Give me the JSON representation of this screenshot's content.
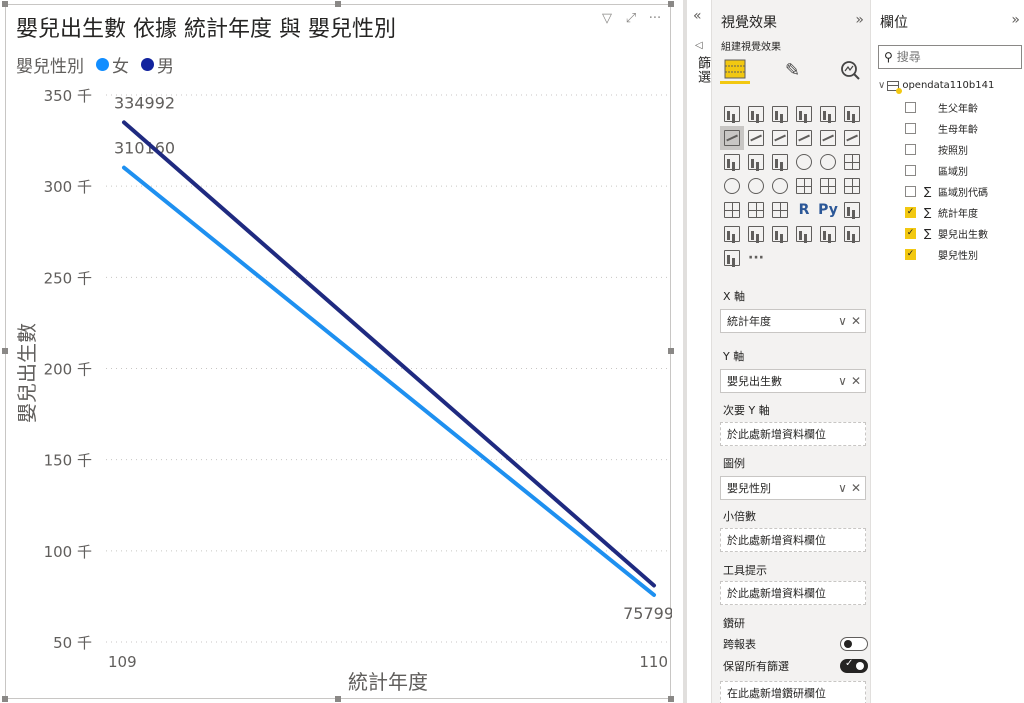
{
  "visual": {
    "title": "嬰兒出生數 依據 統計年度 與 嬰兒性別",
    "header_icons": [
      "filter-icon",
      "focus-mode-icon",
      "more-options-icon"
    ],
    "legend": {
      "title": "嬰兒性別",
      "entries": [
        {
          "label": "女",
          "color": "#118dff"
        },
        {
          "label": "男",
          "color": "#12239e"
        }
      ]
    }
  },
  "chart_data": {
    "type": "line",
    "x": [
      "109",
      "110"
    ],
    "xlabel": "統計年度",
    "ylabel": "嬰兒出生數",
    "yticks": [
      "50 千",
      "100 千",
      "150 千",
      "200 千",
      "250 千",
      "300 千",
      "350 千"
    ],
    "ylim": [
      50000,
      350000
    ],
    "series": [
      {
        "name": "女",
        "color": "#1e90f0",
        "values": [
          310160,
          75799
        ],
        "data_labels": [
          "310160",
          "75799"
        ]
      },
      {
        "name": "男",
        "color": "#1f2a80",
        "values": [
          334992,
          81000
        ],
        "data_labels": [
          "334992",
          ""
        ]
      }
    ],
    "grid": "horizontal-dotted"
  },
  "filters_pane": {
    "label": "篩選"
  },
  "viz_pane": {
    "title": "視覺效果",
    "build_label": "組建視覺效果",
    "gallery": [
      "stacked-bar",
      "stacked-column",
      "clustered-bar",
      "clustered-column",
      "100-stacked-bar",
      "100-stacked-column",
      "line",
      "area",
      "stacked-area",
      "line-and-stacked-column",
      "line-and-clustered-column",
      "ribbon",
      "waterfall",
      "funnel",
      "scatter",
      "pie",
      "donut",
      "treemap",
      "map",
      "filled-map",
      "gauge",
      "card",
      "multi-row-card",
      "kpi",
      "slicer",
      "table",
      "matrix",
      "R",
      "Py",
      "key-influencers",
      "decomposition-tree",
      "qa",
      "smart-narrative",
      "paginated-report",
      "power-apps",
      "power-automate",
      "get-more-visuals",
      "···"
    ],
    "wells": {
      "x_axis": {
        "label": "X 軸",
        "field": "統計年度"
      },
      "y_axis": {
        "label": "Y 軸",
        "field": "嬰兒出生數"
      },
      "secondary_y": {
        "label": "次要 Y 軸",
        "placeholder": "於此處新增資料欄位"
      },
      "legend": {
        "label": "圖例",
        "field": "嬰兒性別"
      },
      "small_multiples": {
        "label": "小倍數",
        "placeholder": "於此處新增資料欄位"
      },
      "tooltips": {
        "label": "工具提示",
        "placeholder": "於此處新增資料欄位"
      }
    },
    "drillthrough": {
      "label": "鑽研",
      "cross_report": "跨報表",
      "keep_filters": "保留所有篩選",
      "placeholder": "在此處新增鑽研欄位"
    }
  },
  "fields_pane": {
    "title": "欄位",
    "search_placeholder": "搜尋",
    "table_name": "opendata110b141",
    "fields": [
      {
        "name": "生父年齡",
        "sigma": false,
        "checked": false
      },
      {
        "name": "生母年齡",
        "sigma": false,
        "checked": false
      },
      {
        "name": "按照別",
        "sigma": false,
        "checked": false
      },
      {
        "name": "區域別",
        "sigma": false,
        "checked": false
      },
      {
        "name": "區域別代碼",
        "sigma": true,
        "checked": false
      },
      {
        "name": "統計年度",
        "sigma": true,
        "checked": true
      },
      {
        "name": "嬰兒出生數",
        "sigma": true,
        "checked": true
      },
      {
        "name": "嬰兒性別",
        "sigma": false,
        "checked": true
      }
    ]
  }
}
